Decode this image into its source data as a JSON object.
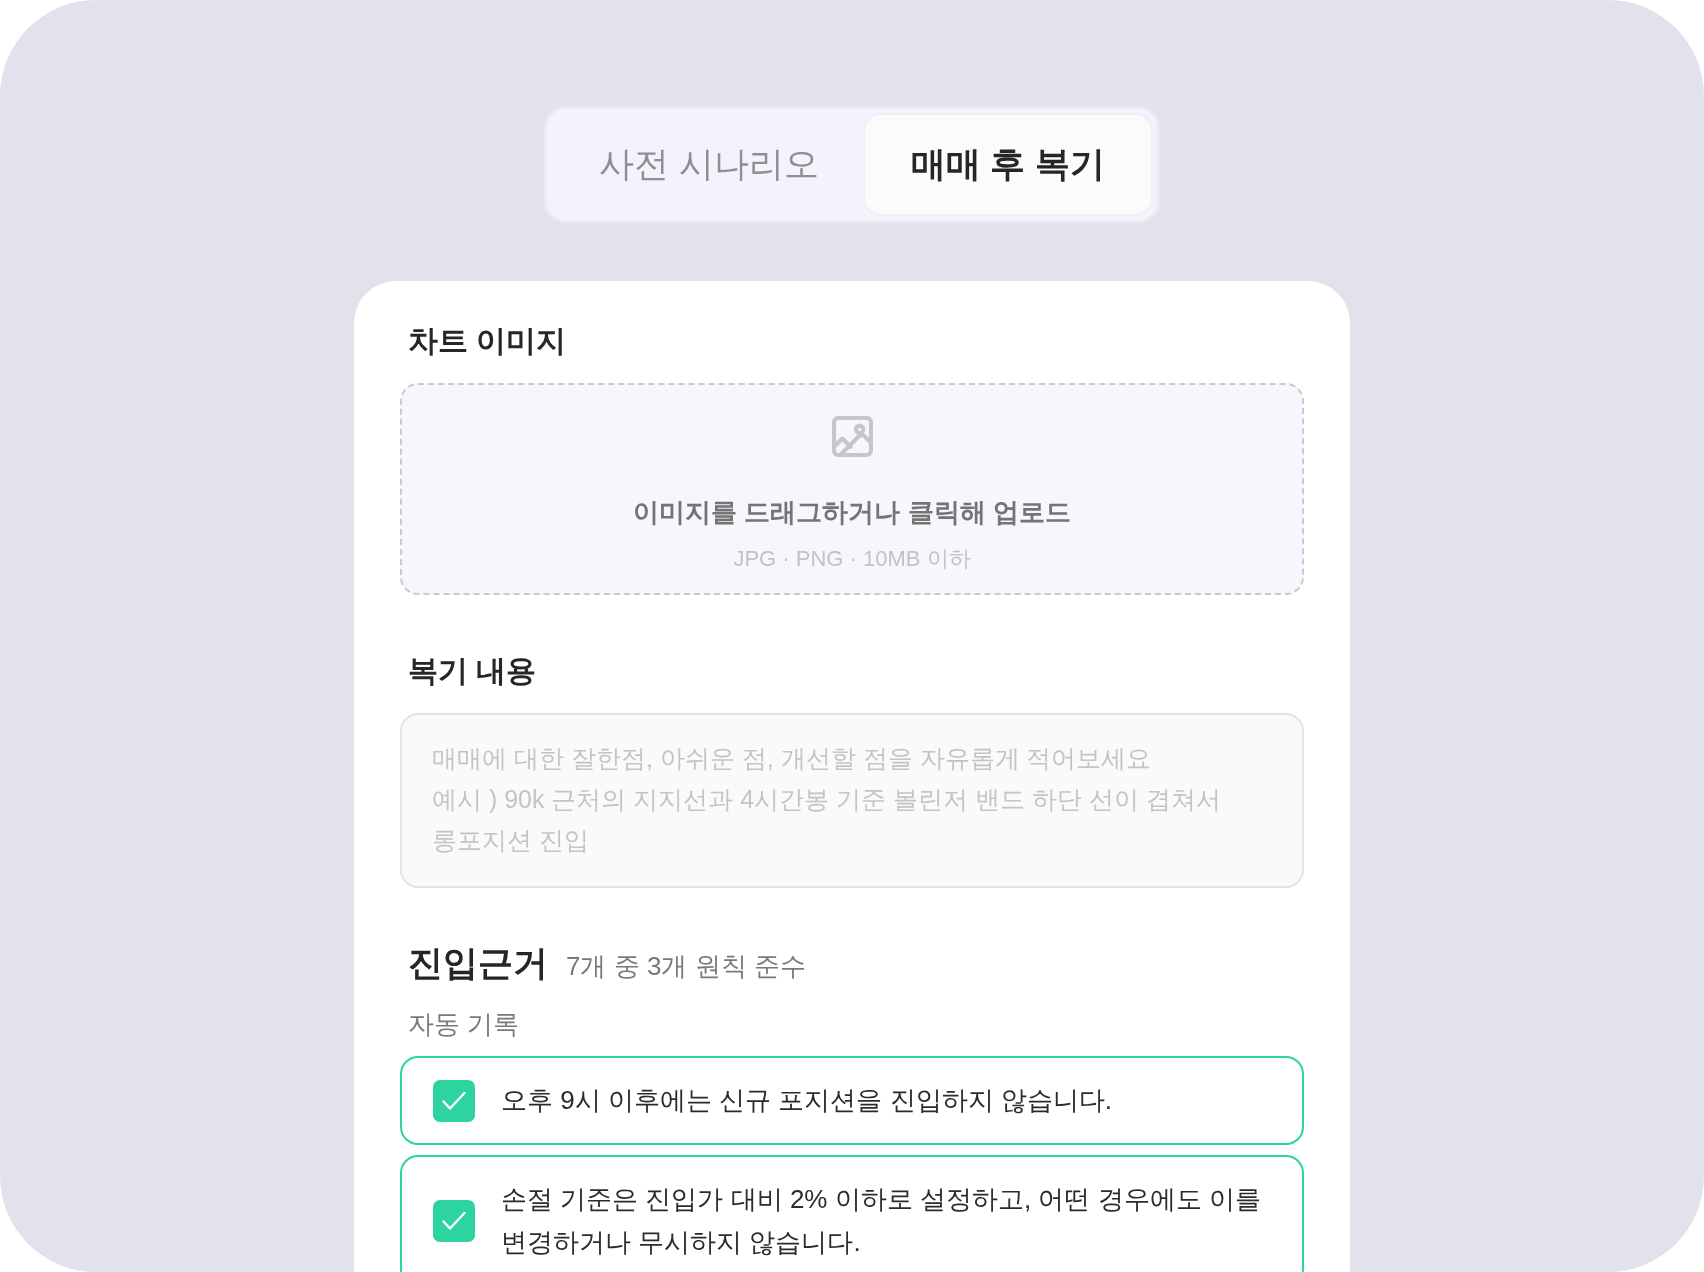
{
  "tabs": [
    {
      "label": "사전 시나리오",
      "selected": false
    },
    {
      "label": "매매 후 복기",
      "selected": true
    }
  ],
  "chart_image": {
    "title": "차트 이미지",
    "upload": {
      "prompt": "이미지를 드래그하거나 클릭해 업로드",
      "hint": "JPG · PNG · 10MB 이하"
    }
  },
  "review": {
    "title": "복기 내용",
    "placeholder": "매매에 대한 잘한점, 아쉬운 점, 개선할 점을 자유롭게 적어보세요\n예시 ) 90k 근처의 지지선과 4시간봉 기준 볼린저 밴드 하단 선이 겹쳐서\n롱포지션 진입"
  },
  "entry_basis": {
    "title": "진입근거",
    "summary": "7개 중 3개 원칙 준수",
    "groups": [
      {
        "label": "자동 기록",
        "rules": [
          {
            "text": "오후 9시 이후에는 신규 포지션을 진입하지 않습니다.",
            "checked": true
          },
          {
            "text": "손절 기준은 진입가 대비 2% 이하로 설정하고, 어떤 경우에도 이를 변경하거나 무시하지 않습니다.",
            "checked": true
          }
        ]
      }
    ]
  }
}
